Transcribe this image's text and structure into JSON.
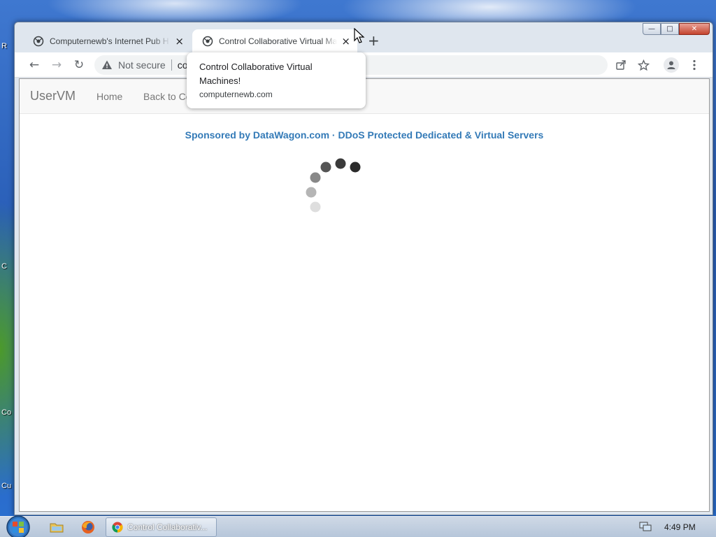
{
  "desktop": {
    "icon_labels": [
      "R",
      "C",
      "Co",
      "Cu"
    ]
  },
  "browser": {
    "tabs": [
      {
        "title": "Computernewb's Internet Pub H",
        "favicon": "computernewb-favicon",
        "close": "×"
      },
      {
        "title": "Control Collaborative Virtual Ma",
        "favicon": "computernewb-favicon",
        "close": "×"
      }
    ],
    "new_tab_label": "+",
    "window_controls": {
      "minimize": "—",
      "maximize": "□",
      "close": "✕"
    },
    "toolbar": {
      "back_icon": "←",
      "forward_icon": "→",
      "reload_icon": "↻",
      "security_label": "Not secure",
      "url": "co"
    },
    "tooltip": {
      "title": "Control Collaborative Virtual Machines!",
      "domain": "computernewb.com"
    }
  },
  "page": {
    "navbar": {
      "brand": "UserVM",
      "links": [
        "Home",
        "Back to Co"
      ]
    },
    "sponsor_text": "Sponsored by DataWagon.com · DDoS Protected Dedicated & Virtual Servers",
    "loading_spinner": "spinner-icon"
  },
  "taskbar": {
    "active_task": "Control Collaborativ...",
    "clock": "4:49 PM"
  },
  "colors": {
    "sponsor_link": "#337ab7",
    "navbar_bg": "#f8f8f8",
    "tab_active_bg": "#ffffff",
    "taskbar": "#c3d1e2"
  }
}
